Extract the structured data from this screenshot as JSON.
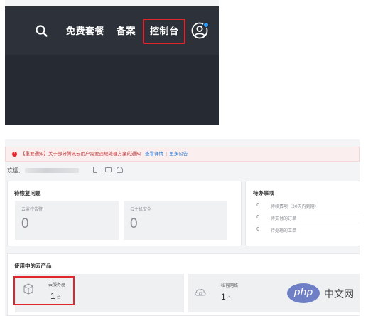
{
  "nav": {
    "icons": {
      "search": "search-icon",
      "account": "user-circle-icon"
    },
    "items": [
      "免费套餐",
      "备案",
      "控制台"
    ],
    "colors": {
      "background": "#2c313a",
      "highlight_box": "#e0262c",
      "notify_dot": "#2a9cff"
    }
  },
  "notice": {
    "icon": "warning-icon",
    "message": "【重要通知】关于部分腾讯云用户需要违规处理方案的通知",
    "detail_link": "查看详情",
    "separator": "|",
    "more_link": "更多公告"
  },
  "welcome": {
    "greeting": "欢迎,",
    "icons": [
      "phone-icon",
      "mail-icon",
      "user-icon"
    ]
  },
  "pending": {
    "title": "待恢复问题",
    "cards": [
      {
        "label": "云监控告警",
        "value": "0"
      },
      {
        "label": "云主机安全",
        "value": "0"
      }
    ]
  },
  "todo": {
    "title": "待办事项",
    "items": [
      {
        "count": "0",
        "label": "待续费项（30天内到期）"
      },
      {
        "count": "0",
        "label": "待支付的订单"
      },
      {
        "count": "0",
        "label": "待处理的工单"
      }
    ]
  },
  "products": {
    "title": "使用中的云产品",
    "items": [
      {
        "name": "云服务器",
        "count": "1",
        "unit": "台",
        "icon": "cube-icon"
      },
      {
        "name": "私有网络",
        "count": "1",
        "unit": "个",
        "icon": "cloud-lock-icon"
      }
    ]
  },
  "watermark": {
    "logo": "php",
    "text": "中文网"
  }
}
